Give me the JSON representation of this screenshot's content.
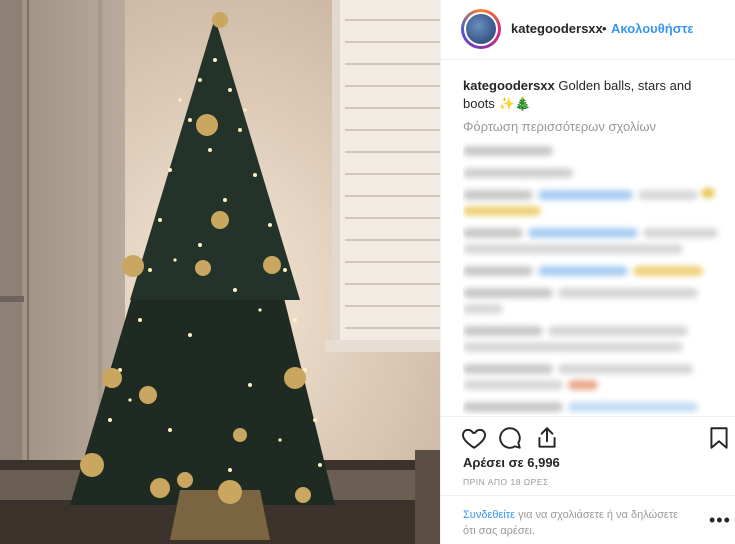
{
  "post": {
    "username": "kategoodersxx",
    "separator": "•",
    "follow_label": "Ακολουθήστε",
    "caption_username": "kategoodersxx",
    "caption_text": "Golden balls, stars and boots",
    "caption_emoji": "✨🎄",
    "load_more": "Φόρτωση περισσότερων σχολίων",
    "likes": "Αρέσει σε 6,996",
    "timestamp": "ΠΡΙΝ ΑΠΟ 18 ΩΡΕΣ",
    "login_link": "Συνδεθείτε",
    "login_rest": " για να σχολιάσετε ή να δηλώσετε ότι σας αρέσει.",
    "more_options": "•••"
  },
  "icons": {
    "like": "heart-icon",
    "comment": "comment-bubble-icon",
    "share": "share-icon",
    "save": "bookmark-icon"
  },
  "colors": {
    "link": "#3897f0",
    "text": "#262626",
    "muted": "#999999"
  }
}
